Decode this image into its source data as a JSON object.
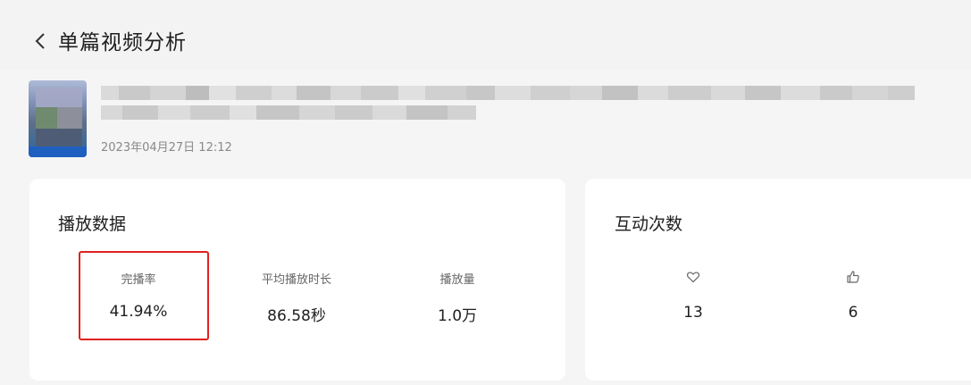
{
  "header": {
    "title": "单篇视频分析"
  },
  "video": {
    "publish_time": "2023年04月27日 12:12"
  },
  "play_card": {
    "title": "播放数据",
    "metrics": [
      {
        "label": "完播率",
        "value": "41.94%"
      },
      {
        "label": "平均播放时长",
        "value": "86.58秒"
      },
      {
        "label": "播放量",
        "value": "1.0万"
      }
    ]
  },
  "interaction_card": {
    "title": "互动次数",
    "items": [
      {
        "icon": "heart-icon",
        "value": "13"
      },
      {
        "icon": "thumbs-up-icon",
        "value": "6"
      }
    ]
  },
  "colors": {
    "highlight": "#e02020",
    "background": "#f5f5f5",
    "card": "#ffffff"
  }
}
